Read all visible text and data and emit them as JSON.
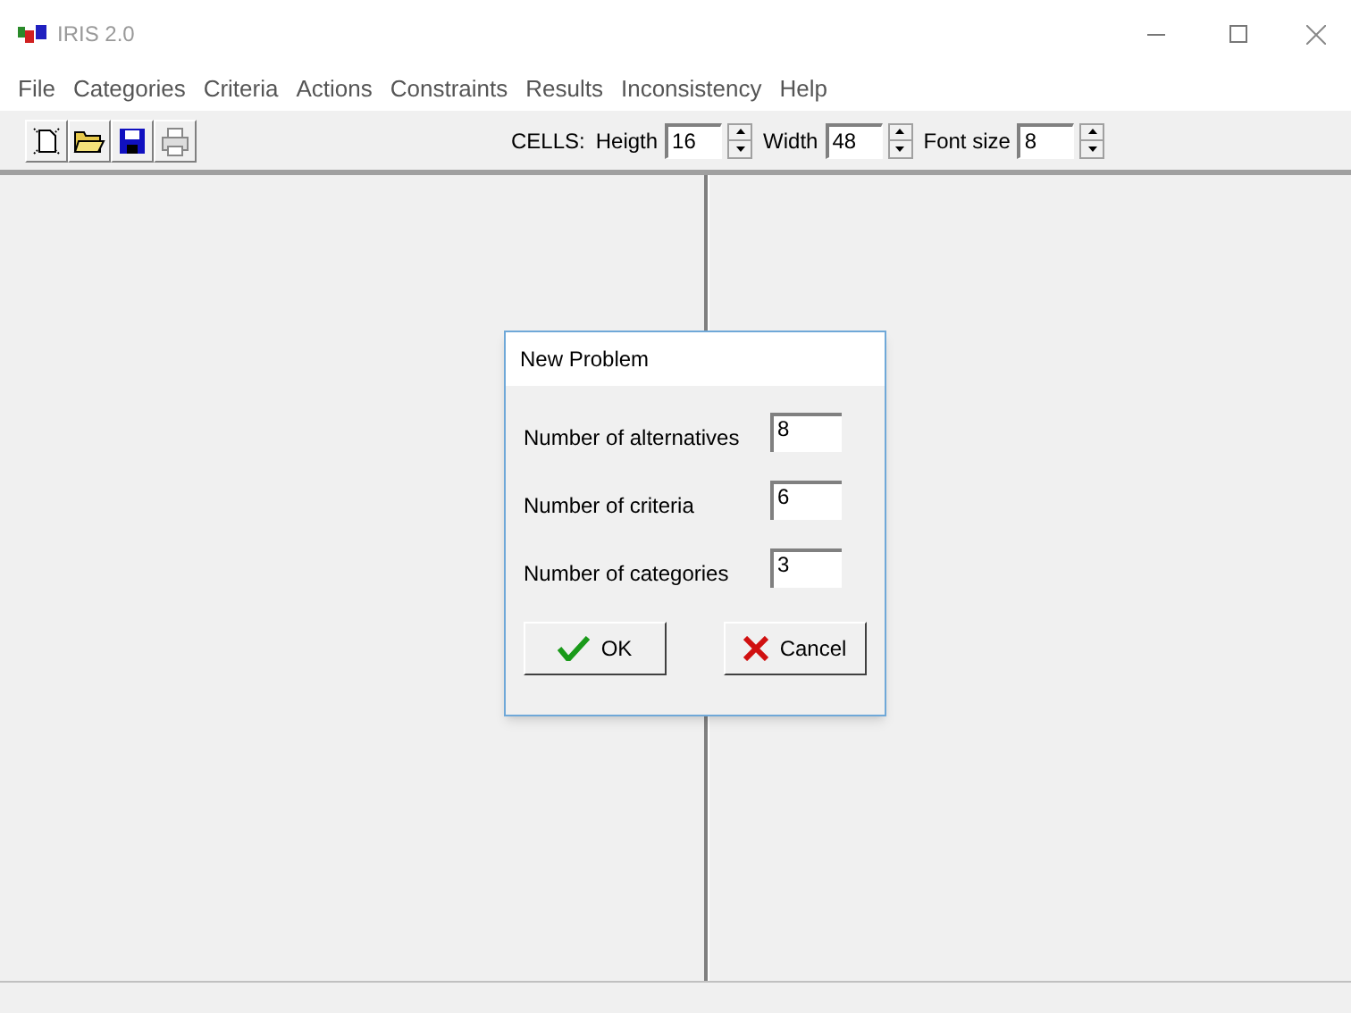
{
  "window": {
    "title": "IRIS 2.0"
  },
  "menu": [
    "File",
    "Categories",
    "Criteria",
    "Actions",
    "Constraints",
    "Results",
    "Inconsistency",
    "Help"
  ],
  "toolbar": {
    "cells_label": "CELLS:",
    "spinners": [
      {
        "label": "Heigth",
        "value": "16"
      },
      {
        "label": "Width",
        "value": "48"
      },
      {
        "label": "Font size",
        "value": "8"
      }
    ]
  },
  "dialog": {
    "title": "New Problem",
    "fields": [
      {
        "label": "Number of alternatives",
        "value": "8"
      },
      {
        "label": "Number of criteria",
        "value": "6"
      },
      {
        "label": "Number of categories",
        "value": "3"
      }
    ],
    "buttons": [
      {
        "kind": "ok",
        "label": "OK"
      },
      {
        "kind": "cancel",
        "label": "Cancel"
      }
    ]
  }
}
